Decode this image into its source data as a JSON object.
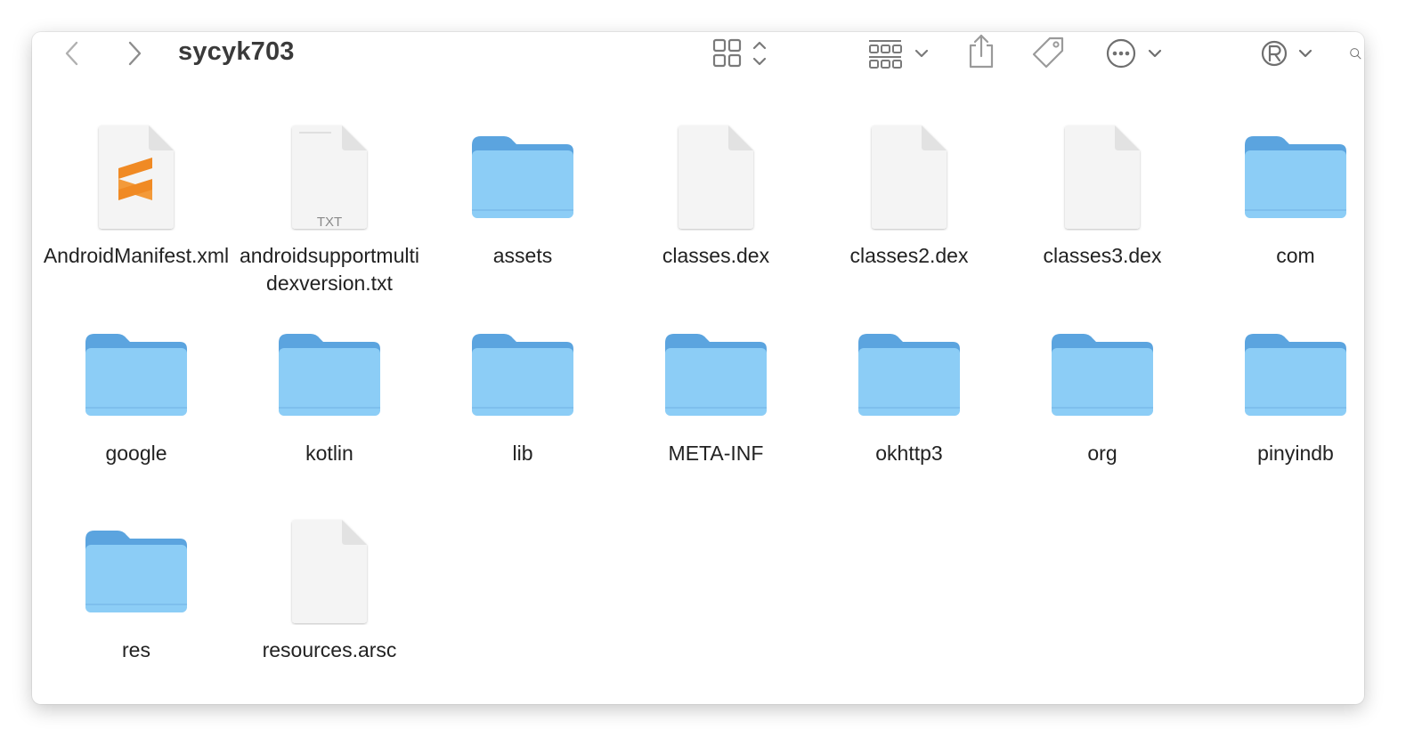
{
  "window": {
    "title": "sycyk703"
  },
  "toolbar": {
    "back_icon": "chevron-left-icon",
    "forward_icon": "chevron-right-icon",
    "view_icon": "icon-grid-icon",
    "group_icon": "group-by-icon",
    "share_icon": "share-icon",
    "tag_icon": "tag-icon",
    "more_icon": "ellipsis-circle-icon",
    "registered_icon": "registered-icon",
    "search_icon": "search-icon"
  },
  "colors": {
    "folder_front": "#8ccdf6",
    "folder_back": "#5ba4df",
    "doc_fill": "#f4f4f4",
    "sublime_orange": "#f08a24"
  },
  "items": [
    {
      "name": "AndroidManifest.xml",
      "kind": "sublime-xml-file-icon"
    },
    {
      "name": "androidsupportmultidexversion.txt",
      "kind": "txt-file-icon",
      "badge": "TXT"
    },
    {
      "name": "assets",
      "kind": "folder-icon"
    },
    {
      "name": "classes.dex",
      "kind": "document-icon"
    },
    {
      "name": "classes2.dex",
      "kind": "document-icon"
    },
    {
      "name": "classes3.dex",
      "kind": "document-icon"
    },
    {
      "name": "com",
      "kind": "folder-icon"
    },
    {
      "name": "google",
      "kind": "folder-icon"
    },
    {
      "name": "kotlin",
      "kind": "folder-icon"
    },
    {
      "name": "lib",
      "kind": "folder-icon"
    },
    {
      "name": "META-INF",
      "kind": "folder-icon"
    },
    {
      "name": "okhttp3",
      "kind": "folder-icon"
    },
    {
      "name": "org",
      "kind": "folder-icon"
    },
    {
      "name": "pinyindb",
      "kind": "folder-icon"
    },
    {
      "name": "res",
      "kind": "folder-icon"
    },
    {
      "name": "resources.arsc",
      "kind": "document-icon"
    }
  ]
}
